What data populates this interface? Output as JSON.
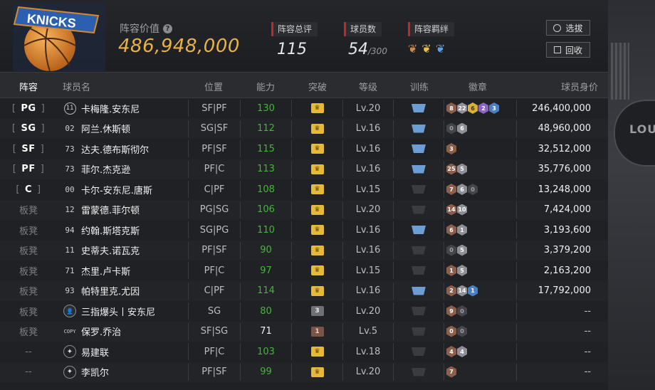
{
  "header": {
    "value_label": "阵容价值",
    "value": "486,948,000",
    "stats": [
      {
        "label": "阵容总评",
        "value": "115",
        "suffix": ""
      },
      {
        "label": "球员数",
        "value": "54",
        "suffix": "/300"
      },
      {
        "label": "阵容羁绊",
        "value": "",
        "suffix": ""
      }
    ],
    "buttons": {
      "select": "选拔",
      "recycle": "回收"
    }
  },
  "columns": [
    "阵容",
    "球员名",
    "位置",
    "能力",
    "突破",
    "等级",
    "训练",
    "徽章",
    "球员身价"
  ],
  "colors": {
    "accent_gold": "#e8b247",
    "rating_green": "#3cbb2f",
    "red_marker": "#c0282e",
    "train_blue": "#6d9ed3"
  },
  "rows": [
    {
      "slot": "PG",
      "starter": true,
      "number": "11",
      "name": "卡梅隆.安东尼",
      "position": "SF|PF",
      "rating": "130",
      "green": true,
      "crown": "gold",
      "crown_text": "♛",
      "level": "Lv.20",
      "train": "blue",
      "badges": [
        [
          "bronze",
          "8"
        ],
        [
          "silver",
          "22"
        ],
        [
          "gold",
          "6"
        ],
        [
          "purple",
          "2"
        ],
        [
          "blue",
          "3"
        ]
      ],
      "value": "246,400,000"
    },
    {
      "slot": "SG",
      "starter": true,
      "number": "02",
      "name": "阿兰.休斯顿",
      "position": "SG|SF",
      "rating": "112",
      "green": true,
      "crown": "gold",
      "crown_text": "♛",
      "level": "Lv.16",
      "train": "blue",
      "badges": [
        [
          "dark",
          "0"
        ],
        [
          "silver",
          "6"
        ]
      ],
      "value": "48,960,000"
    },
    {
      "slot": "SF",
      "starter": true,
      "number": "73",
      "name": "达夫.德布斯彻尔",
      "position": "PF|SF",
      "rating": "115",
      "green": true,
      "crown": "gold",
      "crown_text": "♛",
      "level": "Lv.16",
      "train": "blue",
      "badges": [
        [
          "bronze",
          "3"
        ]
      ],
      "value": "32,512,000"
    },
    {
      "slot": "PF",
      "starter": true,
      "number": "73",
      "name": "菲尔.杰克逊",
      "position": "PF|C",
      "rating": "113",
      "green": true,
      "crown": "gold",
      "crown_text": "♛",
      "level": "Lv.16",
      "train": "blue",
      "badges": [
        [
          "bronze",
          "25"
        ],
        [
          "silver",
          "5"
        ]
      ],
      "value": "35,776,000"
    },
    {
      "slot": "C",
      "starter": true,
      "number": "00",
      "name": "卡尔-安东尼.唐斯",
      "position": "C|PF",
      "rating": "108",
      "green": true,
      "crown": "gold",
      "crown_text": "♛",
      "level": "Lv.15",
      "train": "grey",
      "badges": [
        [
          "bronze",
          "7"
        ],
        [
          "silver",
          "6"
        ],
        [
          "dark",
          "0"
        ]
      ],
      "value": "13,248,000"
    },
    {
      "slot": "板凳",
      "starter": false,
      "number": "12",
      "name": "雷蒙德.菲尔顿",
      "position": "PG|SG",
      "rating": "106",
      "green": true,
      "crown": "gold",
      "crown_text": "♛",
      "level": "Lv.20",
      "train": "grey",
      "badges": [
        [
          "bronze",
          "14"
        ],
        [
          "silver",
          "10"
        ]
      ],
      "value": "7,424,000"
    },
    {
      "slot": "板凳",
      "starter": false,
      "number": "94",
      "name": "约翰.斯塔克斯",
      "position": "SG|PG",
      "rating": "110",
      "green": true,
      "crown": "gold",
      "crown_text": "♛",
      "level": "Lv.16",
      "train": "blue",
      "badges": [
        [
          "bronze",
          "6"
        ],
        [
          "silver",
          "1"
        ]
      ],
      "value": "3,193,600"
    },
    {
      "slot": "板凳",
      "starter": false,
      "number": "11",
      "name": "史蒂夫.诺瓦克",
      "position": "PF|SF",
      "rating": "90",
      "green": true,
      "crown": "gold",
      "crown_text": "♛",
      "level": "Lv.16",
      "train": "grey",
      "badges": [
        [
          "dark",
          "0"
        ],
        [
          "silver",
          "5"
        ]
      ],
      "value": "3,379,200"
    },
    {
      "slot": "板凳",
      "starter": false,
      "number": "71",
      "name": "杰里.卢卡斯",
      "position": "PF|C",
      "rating": "97",
      "green": true,
      "crown": "gold",
      "crown_text": "♛",
      "level": "Lv.15",
      "train": "grey",
      "badges": [
        [
          "bronze",
          "1"
        ],
        [
          "silver",
          "5"
        ]
      ],
      "value": "2,163,200"
    },
    {
      "slot": "板凳",
      "starter": false,
      "number": "93",
      "name": "帕特里克.尤因",
      "position": "C|PF",
      "rating": "114",
      "green": true,
      "crown": "gold",
      "crown_text": "♛",
      "level": "Lv.16",
      "train": "blue",
      "badges": [
        [
          "bronze",
          "2"
        ],
        [
          "silver",
          "14"
        ],
        [
          "blue",
          "1"
        ]
      ],
      "value": "17,792,000"
    },
    {
      "slot": "板凳",
      "starter": false,
      "number": "avatar",
      "name": "三指爆头丨安东尼",
      "position": "SG",
      "rating": "80",
      "green": true,
      "crown": "silver",
      "crown_text": "3",
      "level": "Lv.20",
      "train": "grey",
      "badges": [
        [
          "bronze",
          "9"
        ],
        [
          "dark",
          "0"
        ]
      ],
      "value": "--"
    },
    {
      "slot": "板凳",
      "starter": false,
      "number": "COPY",
      "name": "保罗.乔治",
      "position": "SF|SG",
      "rating": "71",
      "green": false,
      "crown": "bronze",
      "crown_text": "1",
      "level": "Lv.5",
      "train": "grey",
      "badges": [
        [
          "bronze",
          "0"
        ],
        [
          "dark",
          "0"
        ]
      ],
      "value": "--"
    },
    {
      "slot": "--",
      "starter": false,
      "number": "star",
      "name": "易建联",
      "position": "PF|C",
      "rating": "103",
      "green": true,
      "crown": "gold",
      "crown_text": "♛",
      "level": "Lv.18",
      "train": "grey",
      "badges": [
        [
          "bronze",
          "4"
        ],
        [
          "silver",
          "4"
        ]
      ],
      "value": "--"
    },
    {
      "slot": "--",
      "starter": false,
      "number": "star",
      "name": "李凯尔",
      "position": "PF|SF",
      "rating": "99",
      "green": true,
      "crown": "gold",
      "crown_text": "♛",
      "level": "Lv.20",
      "train": "grey",
      "badges": [
        [
          "bronze",
          "7"
        ]
      ],
      "value": "--"
    }
  ]
}
